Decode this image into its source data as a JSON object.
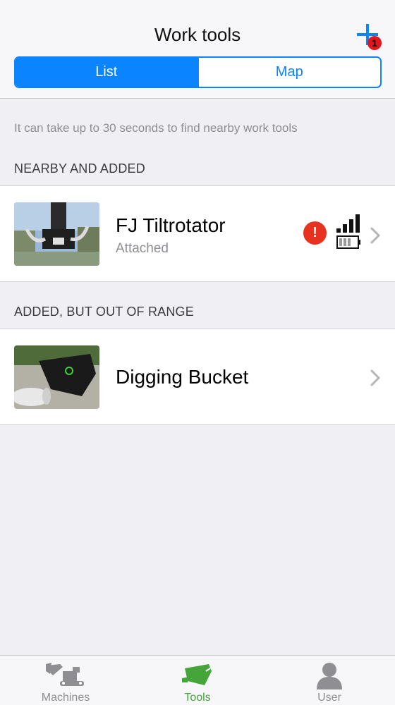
{
  "header": {
    "title": "Work tools",
    "add_badge": "1",
    "segments": [
      "List",
      "Map"
    ],
    "selected_segment": "List"
  },
  "hint": "It can take up to 30 seconds to find nearby work tools",
  "sections": [
    {
      "title": "NEARBY AND ADDED",
      "items": [
        {
          "name": "FJ Tiltrotator",
          "status": "Attached",
          "alert": "!",
          "signal_bars": 4,
          "battery_level": 0.5
        }
      ]
    },
    {
      "title": "ADDED, BUT OUT OF RANGE",
      "items": [
        {
          "name": "Digging Bucket"
        }
      ]
    }
  ],
  "tabbar": {
    "tabs": [
      "Machines",
      "Tools",
      "User"
    ],
    "active": "Tools"
  },
  "colors": {
    "accent": "#0a84ff",
    "active_tab": "#46a53a",
    "alert": "#e6321e",
    "badge": "#e3161b"
  },
  "icons": {
    "add": "plus-icon",
    "alert": "exclamation-icon",
    "signal": "signal-bars-icon",
    "battery": "battery-icon",
    "chevron": "chevron-right-icon",
    "machines": "excavator-icon",
    "tools": "bucket-icon",
    "user": "person-icon"
  }
}
